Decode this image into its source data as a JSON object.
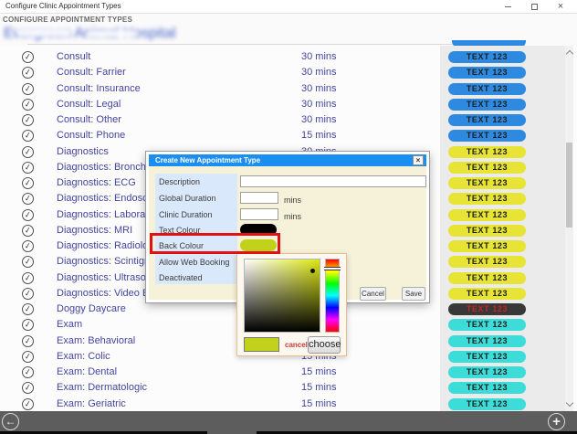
{
  "window": {
    "title": "Configure Clinic Appointment Types",
    "controls": {
      "minimize": "minimize",
      "maximize": "maximize",
      "close": "×"
    }
  },
  "header": {
    "section_title": "CONFIGURE APPOINTMENT TYPES",
    "clinic_name_redacted": "Evergreen Animal Hospital"
  },
  "list": {
    "badge_label": "TEXT 123",
    "badge_styles": {
      "blue": {
        "bg": "#2e8ae0",
        "fg": "#1d1d1d"
      },
      "yellow": {
        "bg": "#e7e435",
        "fg": "#1d1d1d"
      },
      "dark": {
        "bg": "#383838",
        "fg": "#cc2222"
      },
      "cyan": {
        "bg": "#3cdcd8",
        "fg": "#1d1d1d"
      }
    },
    "rows": [
      {
        "label": "Consult",
        "duration": "30 mins",
        "style": "blue"
      },
      {
        "label": "Consult: Farrier",
        "duration": "30 mins",
        "style": "blue"
      },
      {
        "label": "Consult: Insurance",
        "duration": "30 mins",
        "style": "blue"
      },
      {
        "label": "Consult: Legal",
        "duration": "30 mins",
        "style": "blue"
      },
      {
        "label": "Consult: Other",
        "duration": "30 mins",
        "style": "blue"
      },
      {
        "label": "Consult: Phone",
        "duration": "15 mins",
        "style": "blue"
      },
      {
        "label": "Diagnostics",
        "duration": "30 mins",
        "style": "yellow"
      },
      {
        "label": "Diagnostics: Bronchoa",
        "duration": "",
        "style": "yellow"
      },
      {
        "label": "Diagnostics: ECG",
        "duration": "",
        "style": "yellow"
      },
      {
        "label": "Diagnostics: Endoscop",
        "duration": "",
        "style": "yellow"
      },
      {
        "label": "Diagnostics: Laborator",
        "duration": "",
        "style": "yellow"
      },
      {
        "label": "Diagnostics: MRI",
        "duration": "",
        "style": "yellow"
      },
      {
        "label": "Diagnostics: Radiology",
        "duration": "",
        "style": "yellow"
      },
      {
        "label": "Diagnostics: Scintigrap",
        "duration": "",
        "style": "yellow"
      },
      {
        "label": "Diagnostics: Ultrasoun",
        "duration": "",
        "style": "yellow"
      },
      {
        "label": "Diagnostics: Video Enc",
        "duration": "",
        "style": "yellow"
      },
      {
        "label": "Doggy Daycare",
        "duration": "",
        "style": "dark"
      },
      {
        "label": "Exam",
        "duration": "",
        "style": "cyan"
      },
      {
        "label": "Exam: Behavioral",
        "duration": "",
        "style": "cyan"
      },
      {
        "label": "Exam: Colic",
        "duration": "15 mins",
        "style": "cyan"
      },
      {
        "label": "Exam: Dental",
        "duration": "15 mins",
        "style": "cyan"
      },
      {
        "label": "Exam: Dermatologic",
        "duration": "15 mins",
        "style": "cyan"
      },
      {
        "label": "Exam: Geriatric",
        "duration": "15 mins",
        "style": "cyan"
      }
    ]
  },
  "dialog": {
    "title": "Create New Appointment Type",
    "close_label": "×",
    "labels": {
      "description": "Description",
      "global_duration": "Global Duration",
      "clinic_duration": "Clinic Duration",
      "text_colour": "Text Colour",
      "back_colour": "Back Colour",
      "allow_web_booking": "Allow Web Booking",
      "deactivated": "Deactivated"
    },
    "mins_suffix": "mins",
    "description_value": "",
    "global_duration_value": "",
    "clinic_duration_value": "",
    "text_colour_value": "#000000",
    "back_colour_value": "#c2d119",
    "cancel_label": "Cancel",
    "save_label": "Save"
  },
  "color_picker": {
    "hue_color": "#dce711",
    "selected_color": "#c2d119",
    "cancel_label": "cancel",
    "choose_label": "choose"
  }
}
